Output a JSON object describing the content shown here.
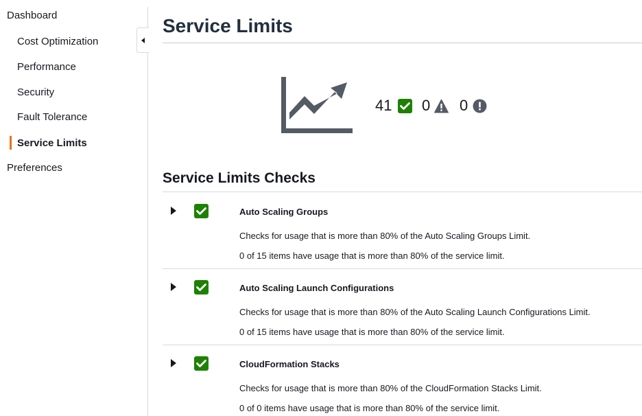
{
  "sidebar": {
    "items": [
      {
        "label": "Dashboard"
      },
      {
        "label": "Cost Optimization"
      },
      {
        "label": "Performance"
      },
      {
        "label": "Security"
      },
      {
        "label": "Fault Tolerance"
      },
      {
        "label": "Service Limits",
        "active": true
      },
      {
        "label": "Preferences"
      }
    ]
  },
  "page": {
    "title": "Service Limits"
  },
  "summary": {
    "icon": "trending-up-chart-icon",
    "ok_count": "41",
    "warning_count": "0",
    "error_count": "0"
  },
  "checks_section": {
    "title": "Service Limits Checks",
    "items": [
      {
        "status": "ok",
        "name": "Auto Scaling Groups",
        "description": "Checks for usage that is more than 80% of the Auto Scaling Groups Limit.",
        "usage": "0 of 15 items have usage that is more than 80% of the service limit."
      },
      {
        "status": "ok",
        "name": "Auto Scaling Launch Configurations",
        "description": "Checks for usage that is more than 80% of the Auto Scaling Launch Configurations Limit.",
        "usage": "0 of 15 items have usage that is more than 80% of the service limit."
      },
      {
        "status": "ok",
        "name": "CloudFormation Stacks",
        "description": "Checks for usage that is more than 80% of the CloudFormation Stacks Limit.",
        "usage": "0 of 0 items have usage that is more than 80% of the service limit."
      }
    ]
  },
  "colors": {
    "ok": "#1d8102",
    "active_accent": "#ec7211",
    "icon_gray": "#545b64"
  }
}
